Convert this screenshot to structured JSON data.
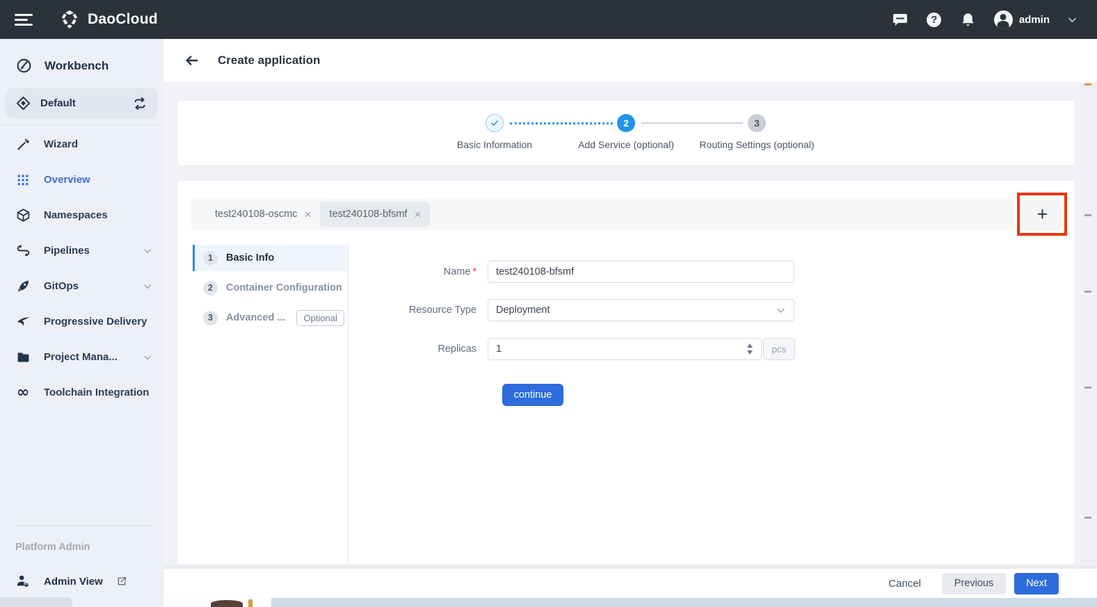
{
  "header": {
    "brand": "DaoCloud",
    "user": "admin"
  },
  "icons": {
    "plus": "+",
    "close": "×",
    "help": "?",
    "infinity": "∞"
  },
  "sidebar": {
    "workbench": "Workbench",
    "workspace": "Default",
    "items": [
      {
        "label": "Wizard"
      },
      {
        "label": "Overview"
      },
      {
        "label": "Namespaces"
      },
      {
        "label": "Pipelines"
      },
      {
        "label": "GitOps"
      },
      {
        "label": "Progressive Delivery"
      },
      {
        "label": "Project Mana..."
      },
      {
        "label": "Toolchain Integration"
      }
    ],
    "section": "Platform Admin",
    "admin_view": "Admin View"
  },
  "page": {
    "title": "Create application",
    "steps": [
      {
        "num": "",
        "label": "Basic Information",
        "state": "done"
      },
      {
        "num": "2",
        "label": "Add Service (optional)",
        "state": "active"
      },
      {
        "num": "3",
        "label": "Routing Settings (optional)",
        "state": "pending"
      }
    ]
  },
  "tabs": [
    {
      "label": "test240108-oscmc"
    },
    {
      "label": "test240108-bfsmf"
    }
  ],
  "subnav": [
    {
      "num": "1",
      "label": "Basic Info"
    },
    {
      "num": "2",
      "label": "Container Configuration"
    },
    {
      "num": "3",
      "label": "Advanced ...",
      "badge": "Optional"
    }
  ],
  "form": {
    "name": {
      "label": "Name",
      "required_mark": "*",
      "value": "test240108-bfsmf"
    },
    "resource_type": {
      "label": "Resource Type",
      "value": "Deployment"
    },
    "replicas": {
      "label": "Replicas",
      "value": "1",
      "unit": "pcs"
    },
    "continue_label": "continue"
  },
  "footer": {
    "cancel": "Cancel",
    "previous": "Previous",
    "next": "Next"
  },
  "colors": {
    "header_bg": "#2b323c",
    "accent_blue": "#2e6cdd",
    "stepper_blue": "#2193e8",
    "link_blue": "#3e6fd9",
    "annotation_red": "#e8370d"
  }
}
